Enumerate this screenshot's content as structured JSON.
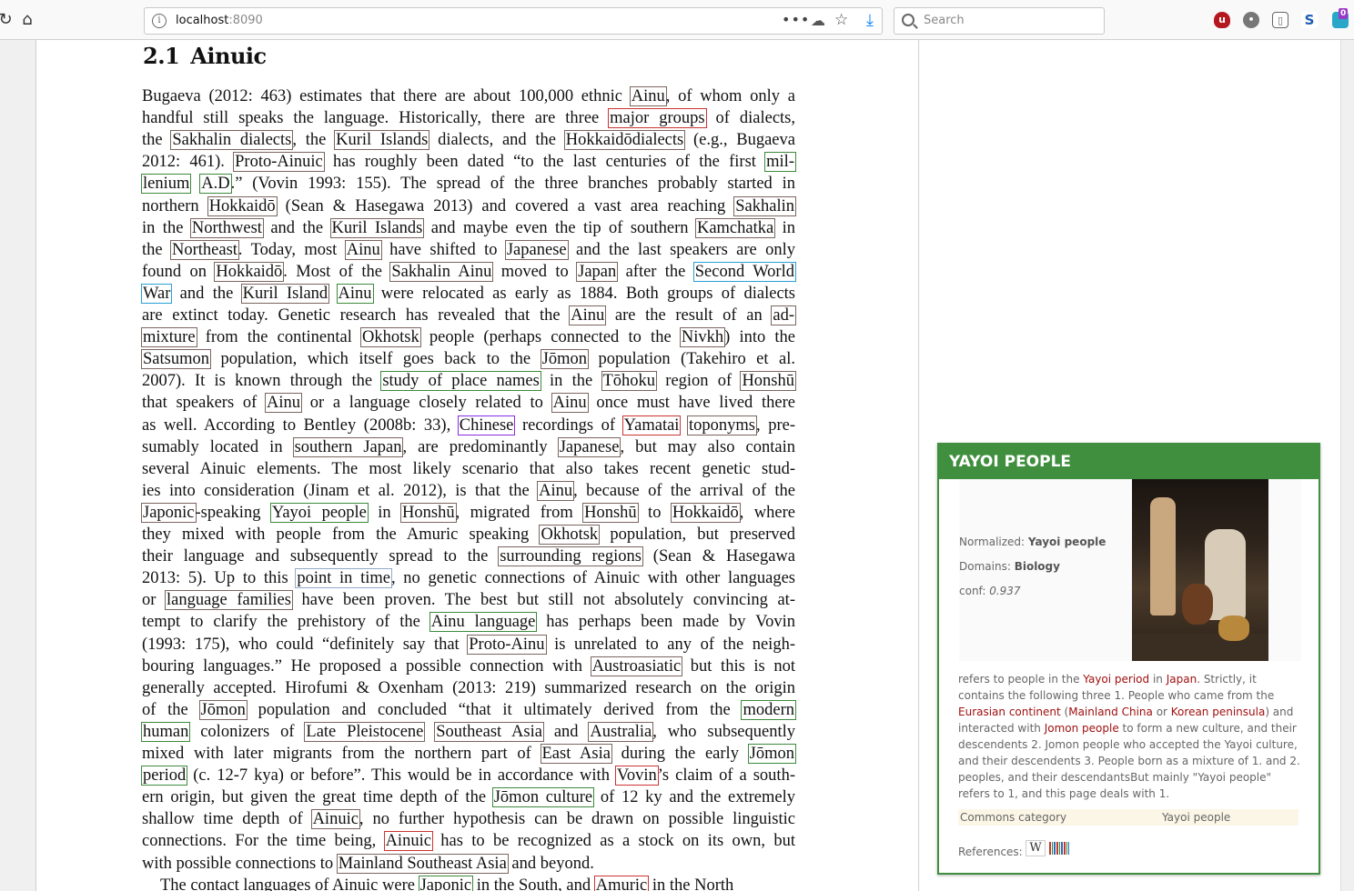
{
  "browser": {
    "url_host": "localhost",
    "url_port": ":8090",
    "search_placeholder": "Search",
    "badge_count": "0"
  },
  "section": {
    "number": "2.1",
    "title": "Ainuic"
  },
  "lines": [
    {
      "j": true,
      "s": [
        [
          "Bugaeva (2012: 463) estimates that there are about 100,000 ethnic "
        ],
        [
          "Ainu",
          "g"
        ],
        [
          ", of whom only a"
        ]
      ]
    },
    {
      "j": true,
      "s": [
        [
          "handful still speaks the language. Historically, there are three "
        ],
        [
          "major groups",
          "red"
        ],
        [
          " of dialects,"
        ]
      ]
    },
    {
      "j": true,
      "s": [
        [
          "the "
        ],
        [
          "Sakhalin dialects",
          "g"
        ],
        [
          ", the "
        ],
        [
          "Kuril Islands",
          "g"
        ],
        [
          " dialects, and the "
        ],
        [
          "Hokkaidōdialects",
          "g"
        ],
        [
          " (e.g., Bugaeva"
        ]
      ]
    },
    {
      "j": true,
      "s": [
        [
          "2012: 461). "
        ],
        [
          "Proto-Ainuic",
          "g"
        ],
        [
          " has roughly been dated “to the last centuries of the first "
        ],
        [
          "mil-",
          "green"
        ]
      ]
    },
    {
      "j": true,
      "s": [
        [
          "lenium",
          "green"
        ],
        [
          " "
        ],
        [
          "A.D",
          "green"
        ],
        [
          ".” (Vovin 1993: 155). The spread of the three branches probably started in"
        ]
      ]
    },
    {
      "j": true,
      "s": [
        [
          "northern "
        ],
        [
          "Hokkaidō",
          "g"
        ],
        [
          " (Sean & Hasegawa 2013) and covered a vast area reaching "
        ],
        [
          "Sakhalin",
          "g"
        ]
      ]
    },
    {
      "j": true,
      "s": [
        [
          "in the "
        ],
        [
          "Northwest",
          "g"
        ],
        [
          " and the "
        ],
        [
          "Kuril Islands",
          "g"
        ],
        [
          " and maybe even the tip of southern "
        ],
        [
          "Kamchatka",
          "g"
        ],
        [
          " in"
        ]
      ]
    },
    {
      "j": true,
      "s": [
        [
          "the "
        ],
        [
          "Northeast",
          "g"
        ],
        [
          ". Today, most "
        ],
        [
          "Ainu",
          "g"
        ],
        [
          " have shifted to "
        ],
        [
          "Japanese",
          "g"
        ],
        [
          " and the last speakers are only"
        ]
      ]
    },
    {
      "j": true,
      "s": [
        [
          "found on "
        ],
        [
          "Hokkaidō",
          "g"
        ],
        [
          ". Most of the "
        ],
        [
          "Sakhalin Ainu",
          "g"
        ],
        [
          " moved to "
        ],
        [
          "Japan",
          "g"
        ],
        [
          " after the "
        ],
        [
          "Second World",
          "blue"
        ]
      ]
    },
    {
      "j": true,
      "s": [
        [
          "War",
          "blue"
        ],
        [
          " and the "
        ],
        [
          "Kuril Island",
          "g"
        ],
        [
          " "
        ],
        [
          "Ainu",
          "green"
        ],
        [
          " were relocated as early as 1884. Both groups of dialects"
        ]
      ]
    },
    {
      "j": true,
      "s": [
        [
          "are extinct today. Genetic research has revealed that the "
        ],
        [
          "Ainu",
          "g"
        ],
        [
          " are the result of an "
        ],
        [
          "ad-",
          "g"
        ]
      ]
    },
    {
      "j": true,
      "s": [
        [
          "mixture",
          "g"
        ],
        [
          " from the continental "
        ],
        [
          "Okhotsk",
          "g"
        ],
        [
          " people (perhaps connected to the "
        ],
        [
          "Nivkh",
          "g"
        ],
        [
          ") into the"
        ]
      ]
    },
    {
      "j": true,
      "s": [
        [
          "Satsumon",
          "g"
        ],
        [
          " population, which itself goes back to the "
        ],
        [
          "Jōmon",
          "g"
        ],
        [
          " population (Takehiro et al."
        ]
      ]
    },
    {
      "j": true,
      "s": [
        [
          "2007). It is known through the "
        ],
        [
          "study of place names",
          "green"
        ],
        [
          " in the "
        ],
        [
          "Tōhoku",
          "g"
        ],
        [
          " region of "
        ],
        [
          "Honshū",
          "g"
        ]
      ]
    },
    {
      "j": true,
      "s": [
        [
          "that speakers of "
        ],
        [
          "Ainu",
          "g"
        ],
        [
          " or a language closely related to "
        ],
        [
          "Ainu",
          "g"
        ],
        [
          " once must have lived there"
        ]
      ]
    },
    {
      "j": true,
      "s": [
        [
          "as well. According to Bentley (2008b: 33), "
        ],
        [
          "Chinese",
          "purple"
        ],
        [
          " recordings of "
        ],
        [
          "Yamatai",
          "red"
        ],
        [
          " "
        ],
        [
          "toponyms",
          "g"
        ],
        [
          ", pre-"
        ]
      ]
    },
    {
      "j": true,
      "s": [
        [
          "sumably located in "
        ],
        [
          "southern Japan",
          "g"
        ],
        [
          ", are predominantly "
        ],
        [
          "Japanese",
          "g"
        ],
        [
          ", but may also contain"
        ]
      ]
    },
    {
      "j": true,
      "s": [
        [
          "several Ainuic elements. The most likely scenario that also takes recent genetic stud-"
        ]
      ]
    },
    {
      "j": true,
      "s": [
        [
          "ies into consideration (Jinam et al. 2012), is that the "
        ],
        [
          "Ainu",
          "g"
        ],
        [
          ", because of the arrival of the"
        ]
      ]
    },
    {
      "j": true,
      "s": [
        [
          "Japonic",
          "g"
        ],
        [
          "-speaking "
        ],
        [
          "Yayoi people",
          "green"
        ],
        [
          " in "
        ],
        [
          "Honshū",
          "g"
        ],
        [
          ", migrated from "
        ],
        [
          "Honshū",
          "g"
        ],
        [
          " to "
        ],
        [
          "Hokkaidō",
          "g"
        ],
        [
          ", where"
        ]
      ]
    },
    {
      "j": true,
      "s": [
        [
          "they mixed with people from the Amuric speaking "
        ],
        [
          "Okhotsk",
          "g"
        ],
        [
          " population, but preserved"
        ]
      ]
    },
    {
      "j": true,
      "s": [
        [
          "their language and subsequently spread to the "
        ],
        [
          "surrounding regions",
          "g"
        ],
        [
          " (Sean & Hasegawa"
        ]
      ]
    },
    {
      "j": true,
      "s": [
        [
          "2013: 5). Up to this "
        ],
        [
          "point in time",
          "lblue"
        ],
        [
          ", no genetic connections of Ainuic with other languages"
        ]
      ]
    },
    {
      "j": true,
      "s": [
        [
          "or "
        ],
        [
          "language families",
          "g"
        ],
        [
          " have been proven. The best but still not absolutely convincing at-"
        ]
      ]
    },
    {
      "j": true,
      "s": [
        [
          "tempt to clarify the prehistory of the "
        ],
        [
          "Ainu language",
          "green"
        ],
        [
          " has perhaps been made by Vovin"
        ]
      ]
    },
    {
      "j": true,
      "s": [
        [
          "(1993: 175), who could “definitely say that "
        ],
        [
          "Proto-Ainu",
          "g"
        ],
        [
          " is unrelated to any of the neigh-"
        ]
      ]
    },
    {
      "j": true,
      "s": [
        [
          "bouring languages.” He proposed a possible connection with "
        ],
        [
          "Austroasiatic",
          "g"
        ],
        [
          " but this is not"
        ]
      ]
    },
    {
      "j": true,
      "s": [
        [
          "generally accepted. Hirofumi & Oxenham (2013: 219) summarized research on the origin"
        ]
      ]
    },
    {
      "j": true,
      "s": [
        [
          "of the "
        ],
        [
          "Jōmon",
          "g"
        ],
        [
          " population and concluded “that it ultimately derived from the "
        ],
        [
          "modern",
          "green"
        ]
      ]
    },
    {
      "j": true,
      "s": [
        [
          "human",
          "green"
        ],
        [
          " colonizers of "
        ],
        [
          "Late Pleistocene",
          "g"
        ],
        [
          " "
        ],
        [
          "Southeast Asia",
          "g"
        ],
        [
          " and "
        ],
        [
          "Australia",
          "g"
        ],
        [
          ", who subsequently"
        ]
      ]
    },
    {
      "j": true,
      "s": [
        [
          "mixed with later migrants from the northern part of "
        ],
        [
          "East Asia",
          "g"
        ],
        [
          " during the early "
        ],
        [
          "Jōmon",
          "green"
        ]
      ]
    },
    {
      "j": true,
      "s": [
        [
          "period",
          "green"
        ],
        [
          " (c. 12-7 kya) or before”. This would be in accordance with "
        ],
        [
          "Vovin",
          "red"
        ],
        [
          "’s claim of a south-"
        ]
      ]
    },
    {
      "j": true,
      "s": [
        [
          "ern origin, but given the great time depth of the "
        ],
        [
          "Jōmon culture",
          "green"
        ],
        [
          " of 12 ky and the extremely"
        ]
      ]
    },
    {
      "j": true,
      "s": [
        [
          "shallow time depth of "
        ],
        [
          "Ainuic",
          "g"
        ],
        [
          ", no further hypothesis can be drawn on possible linguistic"
        ]
      ]
    },
    {
      "j": true,
      "s": [
        [
          "connections. For the time being, "
        ],
        [
          "Ainuic",
          "red"
        ],
        [
          " has to be recognized as a stock on its own, but"
        ]
      ]
    },
    {
      "j": false,
      "s": [
        [
          "with possible connections to "
        ],
        [
          "Mainland Southeast Asia",
          "g"
        ],
        [
          " and beyond."
        ]
      ]
    },
    {
      "j": false,
      "indent": true,
      "s": [
        [
          "The contact languages of Ainuic were "
        ],
        [
          "Japonic",
          "green"
        ],
        [
          " in the South, and "
        ],
        [
          "Amuric",
          "red"
        ],
        [
          " in the North"
        ]
      ]
    }
  ],
  "card": {
    "title": "YAYOI PEOPLE",
    "normalized_label": "Normalized: ",
    "normalized_value": "Yayoi people",
    "domains_label": "Domains: ",
    "domains_value": "Biology",
    "conf_label": "conf: ",
    "conf_value": "0.937",
    "description": [
      [
        "refers to people in the "
      ],
      [
        "Yayoi period",
        "a"
      ],
      [
        " in "
      ],
      [
        "Japan",
        "a"
      ],
      [
        ". Strictly, it contains the following three 1. People who came from the "
      ],
      [
        "Eurasian continent",
        "a"
      ],
      [
        " ("
      ],
      [
        "Mainland China",
        "a"
      ],
      [
        " or "
      ],
      [
        "Korean peninsula",
        "a"
      ],
      [
        ") and interacted with "
      ],
      [
        "Jomon people",
        "a"
      ],
      [
        " to form a new culture, and their descendents 2. Jomon people who accepted the Yayoi culture, and their descendents 3. People born as a mixture of 1. and 2. peoples, and their descendantsBut mainly \"Yayoi people\" refers to 1, and this page deals with 1."
      ]
    ],
    "commons_label": "Commons category",
    "commons_value": "Yayoi people",
    "references_label": "References:",
    "wiki_glyph": "W"
  }
}
